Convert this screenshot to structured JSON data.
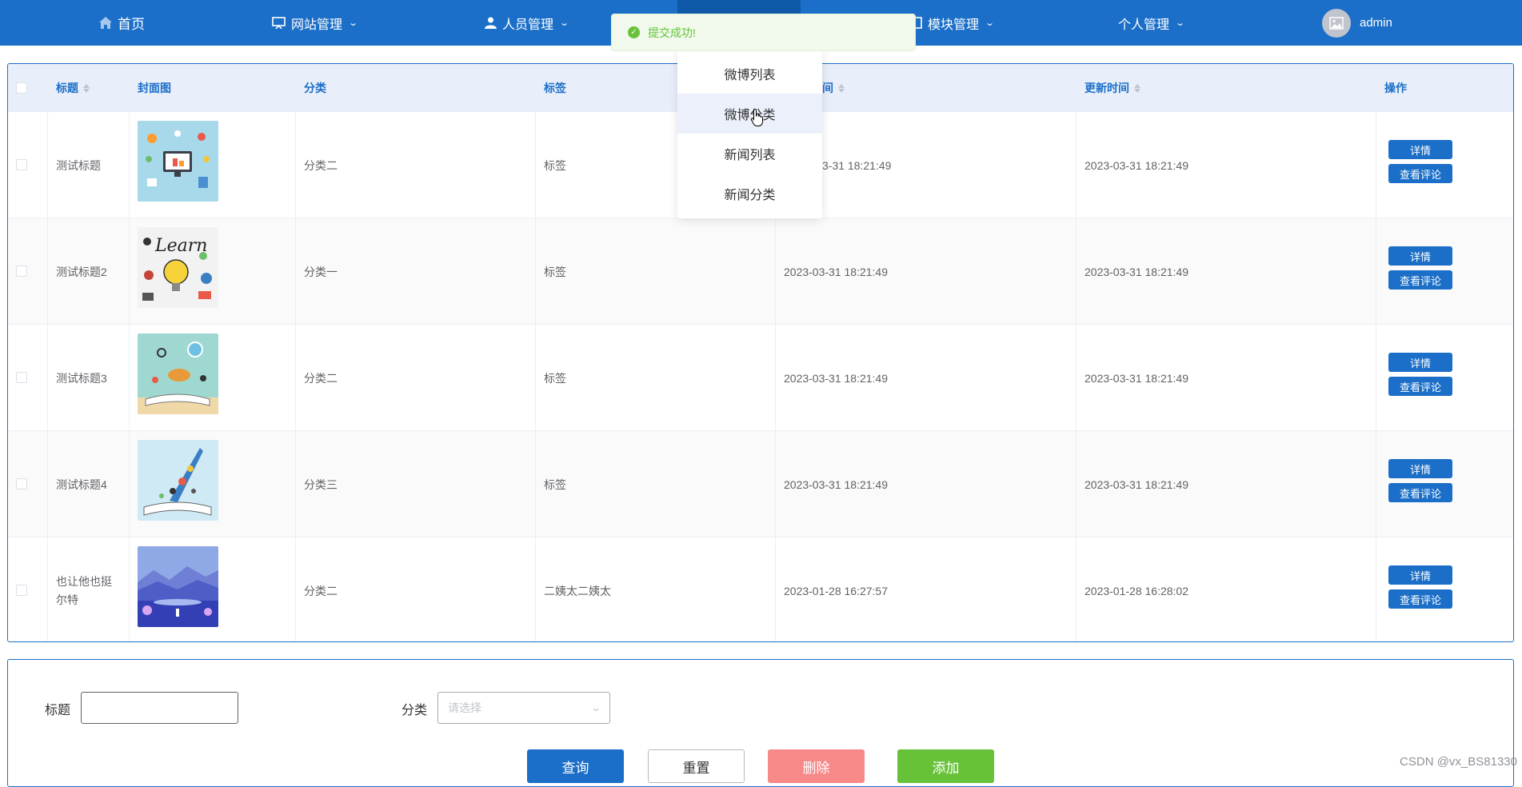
{
  "nav": {
    "home": "首页",
    "site": "网站管理",
    "people": "人员管理",
    "module": "模块管理",
    "personal": "个人管理",
    "user": "admin"
  },
  "toast": {
    "message": "提交成功!"
  },
  "dropdown": {
    "items": [
      "微博列表",
      "微博分类",
      "新闻列表",
      "新闻分类"
    ],
    "hovered": "微博分类"
  },
  "table": {
    "headers": {
      "title": "标题",
      "cover": "封面图",
      "category": "分类",
      "tags": "标签",
      "created": "间",
      "updated": "更新时间",
      "actions": "操作"
    },
    "rows": [
      {
        "title": "测试标题",
        "category": "分类二",
        "tags": "标签",
        "created": "3-31 18:21:49",
        "updated": "2023-03-31 18:21:49",
        "cover": "computer-illustration"
      },
      {
        "title": "测试标题2",
        "category": "分类一",
        "tags": "标签",
        "created": "2023-03-31 18:21:49",
        "updated": "2023-03-31 18:21:49",
        "cover": "learn-lightbulb-illustration"
      },
      {
        "title": "测试标题3",
        "category": "分类二",
        "tags": "标签",
        "created": "2023-03-31 18:21:49",
        "updated": "2023-03-31 18:21:49",
        "cover": "open-book-balloon-illustration"
      },
      {
        "title": "测试标题4",
        "category": "分类三",
        "tags": "标签",
        "created": "2023-03-31 18:21:49",
        "updated": "2023-03-31 18:21:49",
        "cover": "book-rocket-illustration"
      },
      {
        "title": "也让他也挺尔特",
        "category": "分类二",
        "tags": "二姨太二姨太",
        "created": "2023-01-28 16:27:57",
        "updated": "2023-01-28 16:28:02",
        "cover": "blue-mountain-landscape"
      }
    ],
    "detail_label": "详情",
    "comments_label": "查看评论"
  },
  "search": {
    "title_label": "标题",
    "title_value": "",
    "category_label": "分类",
    "category_placeholder": "请选择",
    "query": "查询",
    "reset": "重置",
    "delete": "删除",
    "add": "添加"
  },
  "watermark": "CSDN @vx_BS81330",
  "colors": {
    "primary": "#1b6fc8",
    "success": "#67c23a",
    "danger": "#f78989"
  }
}
